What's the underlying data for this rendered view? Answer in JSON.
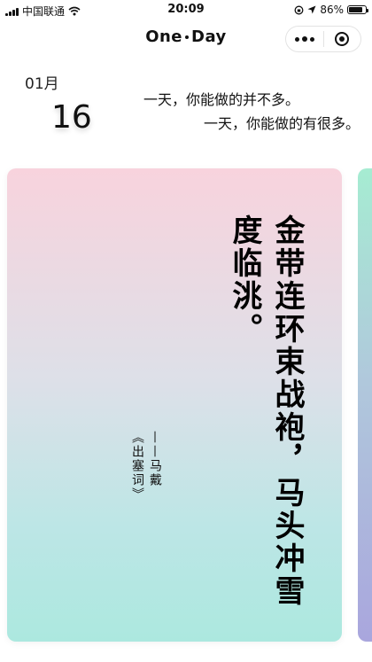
{
  "status_bar": {
    "carrier": "中国联通",
    "time": "20:09",
    "battery": "86%",
    "battery_level": 0.86
  },
  "nav": {
    "title_left": "One",
    "title_right": "Day",
    "icons": [
      "more-icon",
      "close-target-icon"
    ]
  },
  "date": {
    "month": "01月",
    "day": "16"
  },
  "tagline": {
    "line1": "一天，你能做的并不多。",
    "line2": "一天，你能做的有很多。"
  },
  "card": {
    "poem_col1": "金带连环束战袍，马头冲雪",
    "poem_col2": "度临洮。",
    "author_col1": "——马戴",
    "author_col2": "《出塞词》",
    "colors": {
      "gradient_top": "#f8d3dd",
      "gradient_bottom": "#ace8df"
    }
  },
  "next_card": {
    "colors": {
      "top": "#a6ecd2",
      "bottom": "#a9a6dd"
    }
  }
}
